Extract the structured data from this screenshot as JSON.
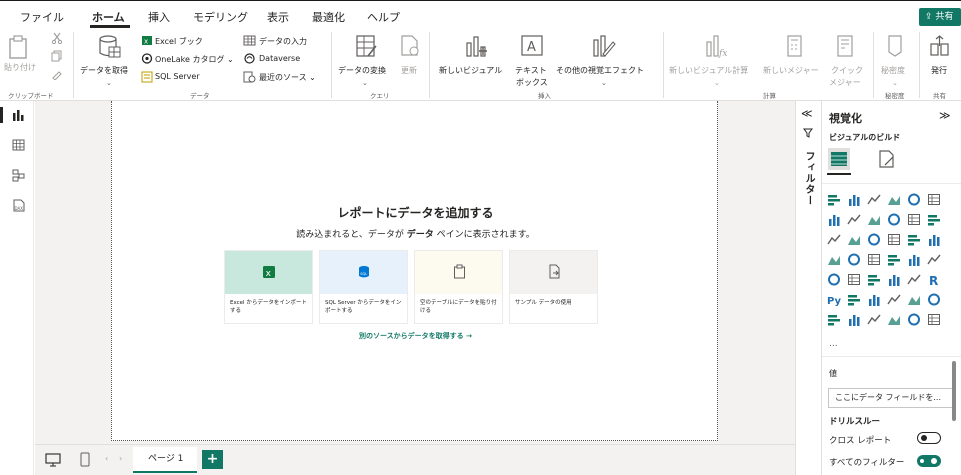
{
  "menu": {
    "tabs": [
      "ファイル",
      "ホーム",
      "挿入",
      "モデリング",
      "表示",
      "最適化",
      "ヘルプ"
    ],
    "share": "共有"
  },
  "ribbon": {
    "clipboard": {
      "paste": "貼り付け",
      "group": "クリップボード"
    },
    "data": {
      "get_data": "データを取得",
      "excel": "Excel ブック",
      "onelake": "OneLake カタログ",
      "sql": "SQL Server",
      "enter_data": "データの入力",
      "dataverse": "Dataverse",
      "recent": "最近のソース",
      "group": "データ"
    },
    "query": {
      "transform": "データの変換",
      "refresh": "更新",
      "group": "クエリ"
    },
    "insert": {
      "new_visual": "新しいビジュアル",
      "text_box_1": "テキスト",
      "text_box_2": "ボックス",
      "more_visuals": "その他の視覚エフェクト",
      "group": "挿入"
    },
    "calc": {
      "new_visual_calc": "新しいビジュアル計算",
      "new_measure": "新しいメジャー",
      "quick_measure_1": "クイック",
      "quick_measure_2": "メジャー",
      "group": "計算"
    },
    "sensitivity": {
      "label": "秘密度",
      "group": "秘密度"
    },
    "share": {
      "publish": "発行",
      "group": "共有"
    }
  },
  "canvas": {
    "title": "レポートにデータを追加する",
    "subtitle_pre": "読み込まれると、データが ",
    "subtitle_bold": "データ",
    "subtitle_post": " ペインに表示されます。",
    "cards": [
      {
        "text": "Excel からデータをインポートする",
        "color": "#c9e8dd"
      },
      {
        "text": "SQL Server からデータをインポートする",
        "color": "#e6f1fb"
      },
      {
        "text": "空のテーブルにデータを貼り付ける",
        "color": "#fdfaf0"
      },
      {
        "text": "サンプル データの使用",
        "color": "#f3f2f1"
      }
    ],
    "other_source": "別のソースからデータを取得する →"
  },
  "bottom": {
    "page_tab": "ページ 1",
    "add": "+"
  },
  "filters": {
    "label": "フィルター"
  },
  "visualizations": {
    "title": "視覚化",
    "build": "ビジュアルのビルド",
    "more": "...",
    "values": "値",
    "field_placeholder": "ここにデータ フィールドを...",
    "drillthrough": "ドリルスルー",
    "cross_report": "クロス レポート",
    "all_filters": "すべてのフィルター",
    "expand": "≫",
    "collapse": "≪"
  },
  "colors": {
    "accent": "#117865",
    "canvas_bg": "#f3f2f1"
  }
}
